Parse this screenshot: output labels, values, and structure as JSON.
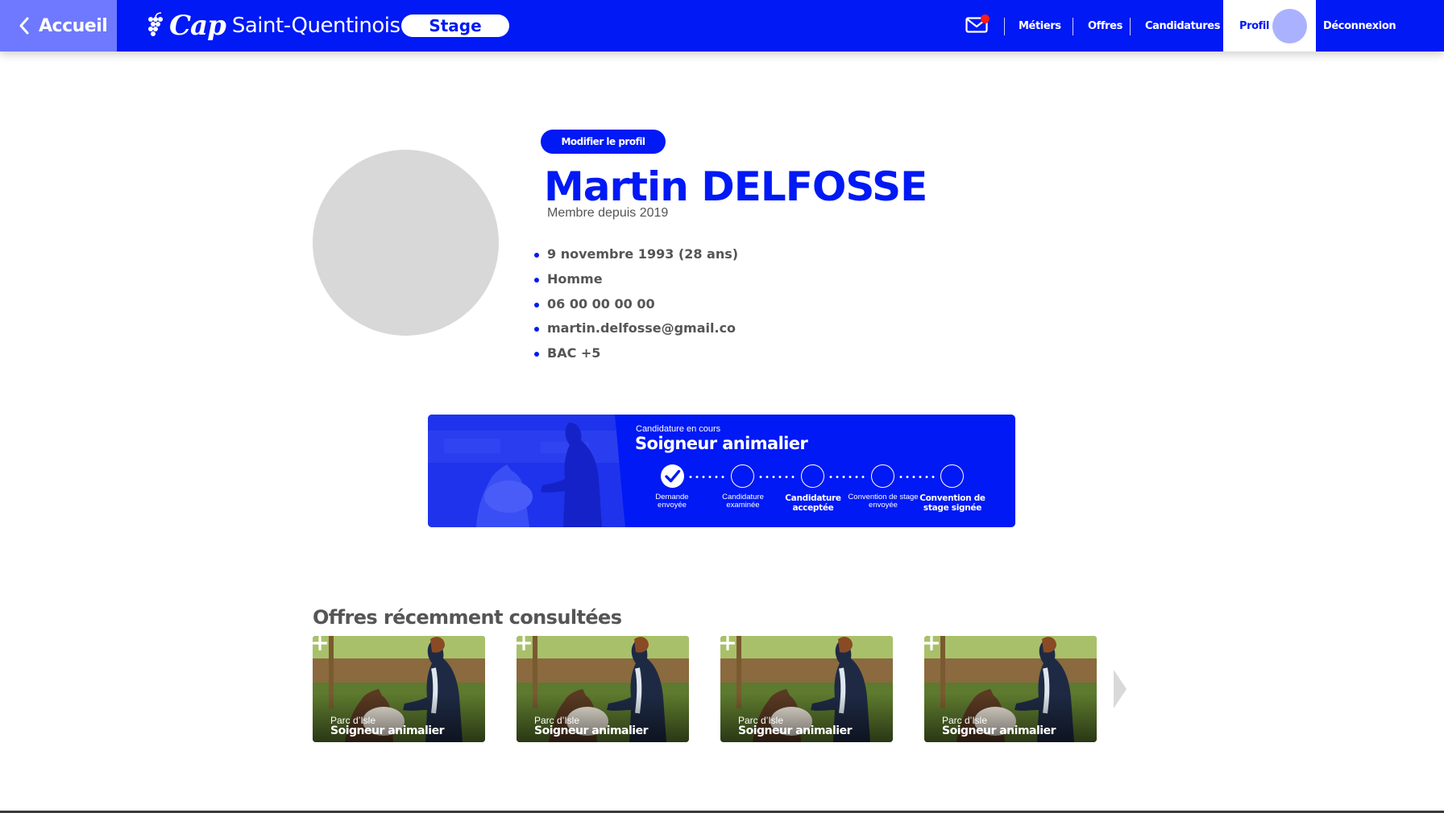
{
  "header": {
    "back_label": "Accueil",
    "logo_cap": "Cap",
    "logo_place": "Saint-Quentinois",
    "section_pill": "Stage",
    "nav": [
      "Métiers",
      "Offres",
      "Candidatures"
    ],
    "profile_label": "Profil",
    "logout_label": "Déconnexion",
    "notification_color": "#ff1a1a"
  },
  "profile": {
    "edit_label": "Modifier le profil",
    "name": "Martin DELFOSSE",
    "member_since": "Membre depuis 2019",
    "details": [
      "9 novembre 1993 (28 ans)",
      "Homme",
      "06 00 00 00 00",
      "martin.delfosse@gmail.co",
      "BAC +5"
    ]
  },
  "application": {
    "kicker": "Candidature en cours",
    "title": "Soigneur animalier",
    "steps": [
      {
        "line1": "Demande",
        "line2": "envoyée",
        "done": true
      },
      {
        "line1": "Candidature",
        "line2": "examinée",
        "done": false
      },
      {
        "line1": "Candidature",
        "line2": "acceptée",
        "done": false
      },
      {
        "line1": "Convention de stage",
        "line2": "envoyée",
        "done": false
      },
      {
        "line1": "Convention de",
        "line2": "stage signée",
        "done": false
      }
    ]
  },
  "recent": {
    "title": "Offres récemment consultées",
    "cards": [
      {
        "place": "Parc d’Isle",
        "job": "Soigneur animalier"
      },
      {
        "place": "Parc d’Isle",
        "job": "Soigneur animalier"
      },
      {
        "place": "Parc d’Isle",
        "job": "Soigneur animalier"
      },
      {
        "place": "Parc d’Isle",
        "job": "Soigneur animalier"
      }
    ]
  },
  "theme": {
    "brand_blue": "#0019f5",
    "back_button": "#6e79ff",
    "avatar_placeholder": "#d8d8d8",
    "text_gray": "#555555"
  }
}
